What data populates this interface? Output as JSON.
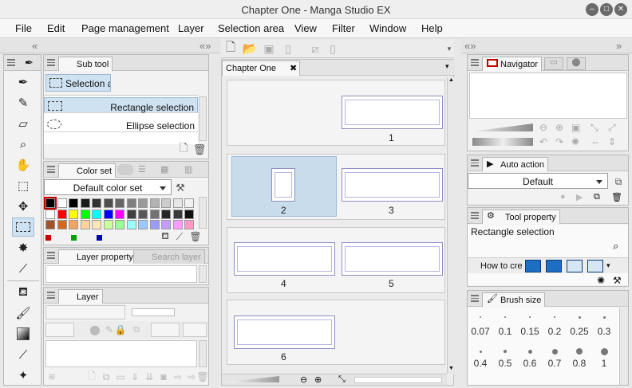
{
  "window": {
    "title": "Chapter One - Manga Studio EX"
  },
  "menu": [
    "File",
    "Edit",
    "Page management",
    "Layer",
    "Selection area",
    "View",
    "Filter",
    "Window",
    "Help"
  ],
  "subtool": {
    "tab": "Sub tool",
    "current": "Selection ar",
    "items": [
      "Rectangle selection",
      "Ellipse selection"
    ]
  },
  "colorset": {
    "tab": "Color set",
    "dropdown": "Default color set"
  },
  "layerprop": {
    "tab": "Layer property",
    "tab2": "Search layer"
  },
  "layer": {
    "tab": "Layer"
  },
  "document": {
    "tab": "Chapter One",
    "pages": [
      "1",
      "2",
      "3",
      "4",
      "5",
      "6"
    ]
  },
  "navigator": {
    "tab": "Navigator"
  },
  "autoaction": {
    "tab": "Auto action",
    "dropdown": "Default"
  },
  "toolproperty": {
    "tab": "Tool property",
    "name": "Rectangle selection",
    "howto": "How to cre"
  },
  "brushsize": {
    "tab": "Brush size",
    "row1": [
      "0.07",
      "0.1",
      "0.15",
      "0.2",
      "0.25",
      "0.3"
    ],
    "row2": [
      "0.4",
      "0.5",
      "0.6",
      "0.7",
      "0.8",
      "1"
    ]
  },
  "colors": {
    "selection": "#cfe2f2",
    "pageBorder": "#8f8fc2"
  }
}
